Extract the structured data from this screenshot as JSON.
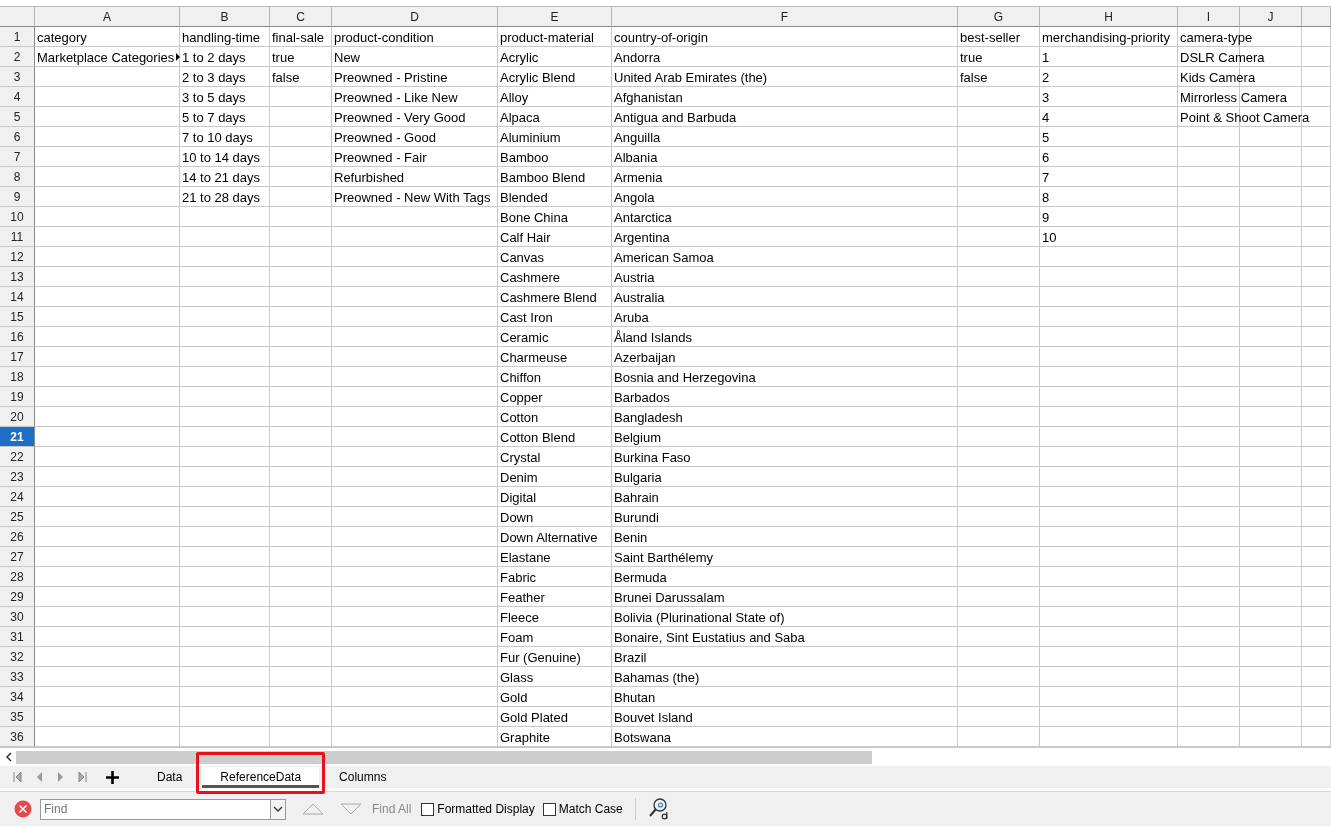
{
  "columns": [
    "A",
    "B",
    "C",
    "D",
    "E",
    "F",
    "G",
    "H",
    "I",
    "J"
  ],
  "rows": [
    {
      "number": "1",
      "selected": false,
      "cells": {
        "A": "category",
        "B": "handling-time",
        "C": "final-sale",
        "D": "product-condition",
        "E": "product-material",
        "F": "country-of-origin",
        "G": "best-seller",
        "H": "merchandising-priority",
        "I": "camera-type"
      }
    },
    {
      "number": "2",
      "selected": false,
      "cells": {
        "A": {
          "text": "Marketplace Categories",
          "overflow": true
        },
        "B": "1 to 2 days",
        "C": "true",
        "D": "New",
        "E": "Acrylic",
        "F": "Andorra",
        "G": "true",
        "H": "1",
        "I": "DSLR Camera"
      }
    },
    {
      "number": "3",
      "selected": false,
      "cells": {
        "B": "2 to 3 days",
        "C": "false",
        "D": "Preowned - Pristine",
        "E": "Acrylic Blend",
        "F": "United Arab Emirates (the)",
        "G": "false",
        "H": "2",
        "I": "Kids Camera"
      }
    },
    {
      "number": "4",
      "selected": false,
      "cells": {
        "B": "3 to 5 days",
        "D": "Preowned - Like New",
        "E": "Alloy",
        "F": "Afghanistan",
        "H": "3",
        "I": "Mirrorless Camera"
      }
    },
    {
      "number": "5",
      "selected": false,
      "cells": {
        "B": "5 to 7 days",
        "D": "Preowned - Very Good",
        "E": "Alpaca",
        "F": "Antigua and Barbuda",
        "H": "4",
        "I": "Point & Shoot Camera"
      }
    },
    {
      "number": "6",
      "selected": false,
      "cells": {
        "B": "7 to 10 days",
        "D": "Preowned - Good",
        "E": "Aluminium",
        "F": "Anguilla",
        "H": "5"
      }
    },
    {
      "number": "7",
      "selected": false,
      "cells": {
        "B": "10 to 14 days",
        "D": "Preowned - Fair",
        "E": "Bamboo",
        "F": "Albania",
        "H": "6"
      }
    },
    {
      "number": "8",
      "selected": false,
      "cells": {
        "B": "14 to 21 days",
        "D": "Refurbished",
        "E": "Bamboo Blend",
        "F": "Armenia",
        "H": "7"
      }
    },
    {
      "number": "9",
      "selected": false,
      "cells": {
        "B": "21 to 28 days",
        "D": "Preowned - New With Tags",
        "E": "Blended",
        "F": "Angola",
        "H": "8"
      }
    },
    {
      "number": "10",
      "selected": false,
      "cells": {
        "E": "Bone China",
        "F": "Antarctica",
        "H": "9"
      }
    },
    {
      "number": "11",
      "selected": false,
      "cells": {
        "E": "Calf Hair",
        "F": "Argentina",
        "H": "10"
      }
    },
    {
      "number": "12",
      "selected": false,
      "cells": {
        "E": "Canvas",
        "F": "American Samoa"
      }
    },
    {
      "number": "13",
      "selected": false,
      "cells": {
        "E": "Cashmere",
        "F": "Austria"
      }
    },
    {
      "number": "14",
      "selected": false,
      "cells": {
        "E": "Cashmere Blend",
        "F": "Australia"
      }
    },
    {
      "number": "15",
      "selected": false,
      "cells": {
        "E": "Cast Iron",
        "F": "Aruba"
      }
    },
    {
      "number": "16",
      "selected": false,
      "cells": {
        "E": "Ceramic",
        "F": "Åland Islands"
      }
    },
    {
      "number": "17",
      "selected": false,
      "cells": {
        "E": "Charmeuse",
        "F": "Azerbaijan"
      }
    },
    {
      "number": "18",
      "selected": false,
      "cells": {
        "E": "Chiffon",
        "F": "Bosnia and Herzegovina"
      }
    },
    {
      "number": "19",
      "selected": false,
      "cells": {
        "E": "Copper",
        "F": "Barbados"
      }
    },
    {
      "number": "20",
      "selected": false,
      "cells": {
        "E": "Cotton",
        "F": "Bangladesh"
      }
    },
    {
      "number": "21",
      "selected": true,
      "cells": {
        "E": "Cotton Blend",
        "F": "Belgium"
      }
    },
    {
      "number": "22",
      "selected": false,
      "cells": {
        "E": "Crystal",
        "F": "Burkina Faso"
      }
    },
    {
      "number": "23",
      "selected": false,
      "cells": {
        "E": "Denim",
        "F": "Bulgaria"
      }
    },
    {
      "number": "24",
      "selected": false,
      "cells": {
        "E": "Digital",
        "F": "Bahrain"
      }
    },
    {
      "number": "25",
      "selected": false,
      "cells": {
        "E": "Down",
        "F": "Burundi"
      }
    },
    {
      "number": "26",
      "selected": false,
      "cells": {
        "E": "Down Alternative",
        "F": "Benin"
      }
    },
    {
      "number": "27",
      "selected": false,
      "cells": {
        "E": "Elastane",
        "F": "Saint Barthélemy"
      }
    },
    {
      "number": "28",
      "selected": false,
      "cells": {
        "E": "Fabric",
        "F": "Bermuda"
      }
    },
    {
      "number": "29",
      "selected": false,
      "cells": {
        "E": "Feather",
        "F": "Brunei Darussalam"
      }
    },
    {
      "number": "30",
      "selected": false,
      "cells": {
        "E": "Fleece",
        "F": "Bolivia (Plurinational State of)"
      }
    },
    {
      "number": "31",
      "selected": false,
      "cells": {
        "E": "Foam",
        "F": "Bonaire, Sint Eustatius and Saba"
      }
    },
    {
      "number": "32",
      "selected": false,
      "cells": {
        "E": "Fur (Genuine)",
        "F": "Brazil"
      }
    },
    {
      "number": "33",
      "selected": false,
      "cells": {
        "E": "Glass",
        "F": "Bahamas (the)"
      }
    },
    {
      "number": "34",
      "selected": false,
      "cells": {
        "E": "Gold",
        "F": "Bhutan"
      }
    },
    {
      "number": "35",
      "selected": false,
      "cells": {
        "E": "Gold Plated",
        "F": "Bouvet Island"
      }
    },
    {
      "number": "36",
      "selected": false,
      "cells": {
        "E": "Graphite",
        "F": "Botswana"
      }
    }
  ],
  "sheet_tabs": [
    {
      "label": "Data",
      "selected": false,
      "highlighted": false
    },
    {
      "label": "ReferenceData",
      "selected": true,
      "highlighted": true
    },
    {
      "label": "Columns",
      "selected": false,
      "highlighted": false
    }
  ],
  "find_bar": {
    "placeholder": "Find",
    "find_all": {
      "label": "Find All",
      "disabled": true
    },
    "options": [
      {
        "label": "Formatted Display",
        "checked": false
      },
      {
        "label": "Match Case",
        "checked": false
      }
    ]
  }
}
